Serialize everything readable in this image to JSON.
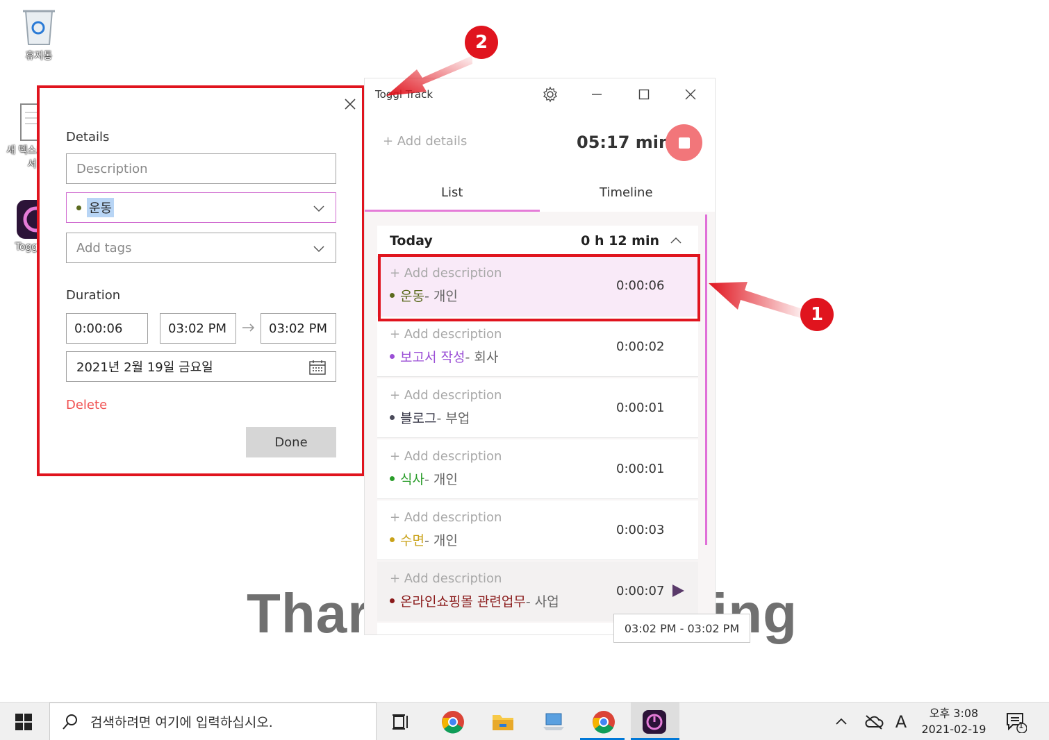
{
  "desktop": {
    "icons": [
      {
        "label": "휴지통",
        "icon": "recycle-bin-icon"
      },
      {
        "label": "새 텍스트 문서",
        "icon": "text-document-icon"
      },
      {
        "label": "Toggl",
        "icon": "toggl-shortcut-icon"
      }
    ],
    "watermark_left": "Thar",
    "watermark_right": "ing"
  },
  "details_dialog": {
    "section_details": "Details",
    "description_placeholder": "Description",
    "project": {
      "name": "운동",
      "color": "#5b6a1e"
    },
    "tags_placeholder": "Add tags",
    "section_duration": "Duration",
    "duration": "0:00:06",
    "start_time": "03:02 PM",
    "end_time": "03:02 PM",
    "date": "2021년 2월 19일 금요일",
    "delete_label": "Delete",
    "done_label": "Done"
  },
  "toggl_window": {
    "title": "Toggl Track",
    "add_details": "+ Add details",
    "timer": "05:17 min",
    "tabs": [
      {
        "label": "List",
        "active": true
      },
      {
        "label": "Timeline",
        "active": false
      }
    ],
    "day": {
      "label": "Today",
      "total": "0 h 12 min"
    },
    "entries": [
      {
        "description": "+ Add description",
        "project": "운동",
        "client": " - 개인",
        "project_color": "#5b6a1e",
        "duration": "0:00:06"
      },
      {
        "description": "+ Add description",
        "project": "보고서 작성",
        "client": " - 회사",
        "project_color": "#9b4fd6",
        "duration": "0:00:02"
      },
      {
        "description": "+ Add description",
        "project": "블로그",
        "client": " - 부업",
        "project_color": "#4a4a5a",
        "duration": "0:00:01"
      },
      {
        "description": "+ Add description",
        "project": "식사",
        "client": " - 개인",
        "project_color": "#2a9d2a",
        "duration": "0:00:01"
      },
      {
        "description": "+ Add description",
        "project": "수면",
        "client": " - 개인",
        "project_color": "#c9a219",
        "duration": "0:00:03"
      },
      {
        "description": "+ Add description",
        "project": "온라인쇼핑몰 관련업무",
        "client": " - 사업",
        "project_color": "#8a1a1a",
        "duration": "0:00:07"
      }
    ],
    "tooltip": "03:02 PM - 03:02 PM"
  },
  "annotations": {
    "badge_1": "1",
    "badge_2": "2"
  },
  "taskbar": {
    "search_placeholder": "검색하려면 여기에 입력하십시오.",
    "clock_time": "오후 3:08",
    "clock_date": "2021-02-19",
    "ime": "A",
    "notification_count": "1"
  },
  "colors": {
    "accent": "#e57cd8",
    "stop_button": "#f2767a",
    "annotation_red": "#e0141e",
    "delete": "#f05050"
  }
}
